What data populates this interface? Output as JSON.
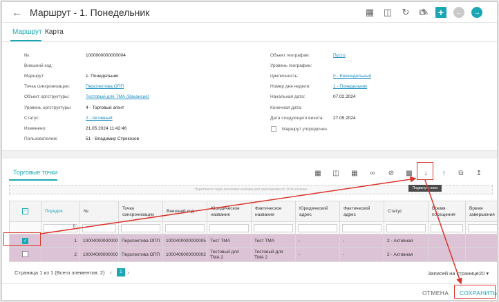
{
  "header": {
    "back_icon": "arrow-left-icon",
    "title": "Маршрут - 1. Понедельник",
    "toolbar_icons": [
      "grid-settings-icon",
      "grid-close-icon",
      "refresh-icon",
      "copy-icon",
      "edit-icon",
      "add-icon",
      "previous-icon",
      "next-icon"
    ],
    "accent": "#1aa7b4"
  },
  "tabs": [
    {
      "label": "Маршрут",
      "active": true
    },
    {
      "label": "Карта",
      "active": false
    }
  ],
  "form_left": [
    {
      "label": "№:",
      "value": "1000000000000004",
      "link": false
    },
    {
      "label": "Внешний код:",
      "value": "",
      "link": false
    },
    {
      "label": "Маршрут:",
      "value": "1. Понедельник",
      "link": false
    },
    {
      "label": "Точка синхронизации:",
      "value": "Перспектива ОПП",
      "link": true
    },
    {
      "label": "Объект оргструктуры:",
      "value": "Тестовый для ТМА (Вакансия)",
      "link": true
    },
    {
      "label": "Уровень оргструктуры:",
      "value": "4 - Торговый агент",
      "link": false
    },
    {
      "label": "Статус:",
      "value": "2 - Активный",
      "link": true
    },
    {
      "label": "Изменено:",
      "value": "21.05.2024 11:42:46",
      "link": false
    },
    {
      "label": "Пользователем:",
      "value": "51 - Владимир Стрекозов",
      "link": false
    }
  ],
  "form_right": [
    {
      "label": "Объект географии:",
      "value": "Пусто",
      "link": true
    },
    {
      "label": "Уровень географии:",
      "value": "",
      "link": false
    },
    {
      "label": "Цикличность:",
      "value": "0 - Еженедельный",
      "link": true
    },
    {
      "label": "Номер дня недели:",
      "value": "1 - Понедельник",
      "link": true
    },
    {
      "label": "Начальная дата:",
      "value": "07.02.2024",
      "link": false
    },
    {
      "label": "Конечная дата:",
      "value": "",
      "link": false
    },
    {
      "label": "Дата следующего визита:",
      "value": "27.05.2024",
      "link": false
    }
  ],
  "ordered_checkbox": {
    "label": "Маршрут упорядочен",
    "checked": false
  },
  "trade_points": {
    "tab_label": "Торговые точки",
    "toolbar_icons": [
      "grid-settings-icon",
      "grid-close-icon",
      "map-icon",
      "link-icon",
      "unlink-icon",
      "search-doc-icon",
      "arrow-down-icon",
      "arrow-up-icon",
      "copy-icon",
      "upload-icon"
    ],
    "group_hint": "Перетяните сюда заголовок колонки для группировки по этой колонке",
    "tooltip": "Подвинуть вниз",
    "columns": [
      "",
      "Порядок",
      "№",
      "Точка синхронизации",
      "Внешний код",
      "Юридическое название",
      "Фактическое название",
      "Юридический адрес",
      "Фактический адрес",
      "Статус",
      "Время посещения",
      "Время завершения"
    ],
    "order_filter_value": "0",
    "rows": [
      {
        "checked": true,
        "order": "1",
        "num": "1000400000000005",
        "sync": "Перспектива ОПП",
        "ext": "1000400000000005",
        "legal": "Тест ТМА",
        "actual": "Тест ТМА",
        "legal_addr": "-",
        "actual_addr": "-",
        "status": "2 - Активная",
        "visit": "",
        "end": ""
      },
      {
        "checked": false,
        "order": "2",
        "num": "1000400000000002",
        "sync": "Перспектива ОПП",
        "ext": "1000400000000002",
        "legal": "Тестовый для ТМА 2",
        "actual": "Тестовый для ТМА 2",
        "legal_addr": "-",
        "actual_addr": "-",
        "status": "2 - Активная",
        "visit": "",
        "end": ""
      }
    ],
    "row_color": "#dcc3d5"
  },
  "pager": {
    "text": "Страница 1 из 1 (Всего элементов: 2)",
    "current_page": "1",
    "prev_icon": "chevron-left-icon",
    "next_icon": "chevron-right-icon",
    "per_page_label": "Записей на странице:",
    "per_page_value": "20 ▾"
  },
  "footer": {
    "cancel_label": "ОТМЕНА",
    "save_label": "СОХРАНИТЬ"
  },
  "annotation_color": "#d9342b"
}
